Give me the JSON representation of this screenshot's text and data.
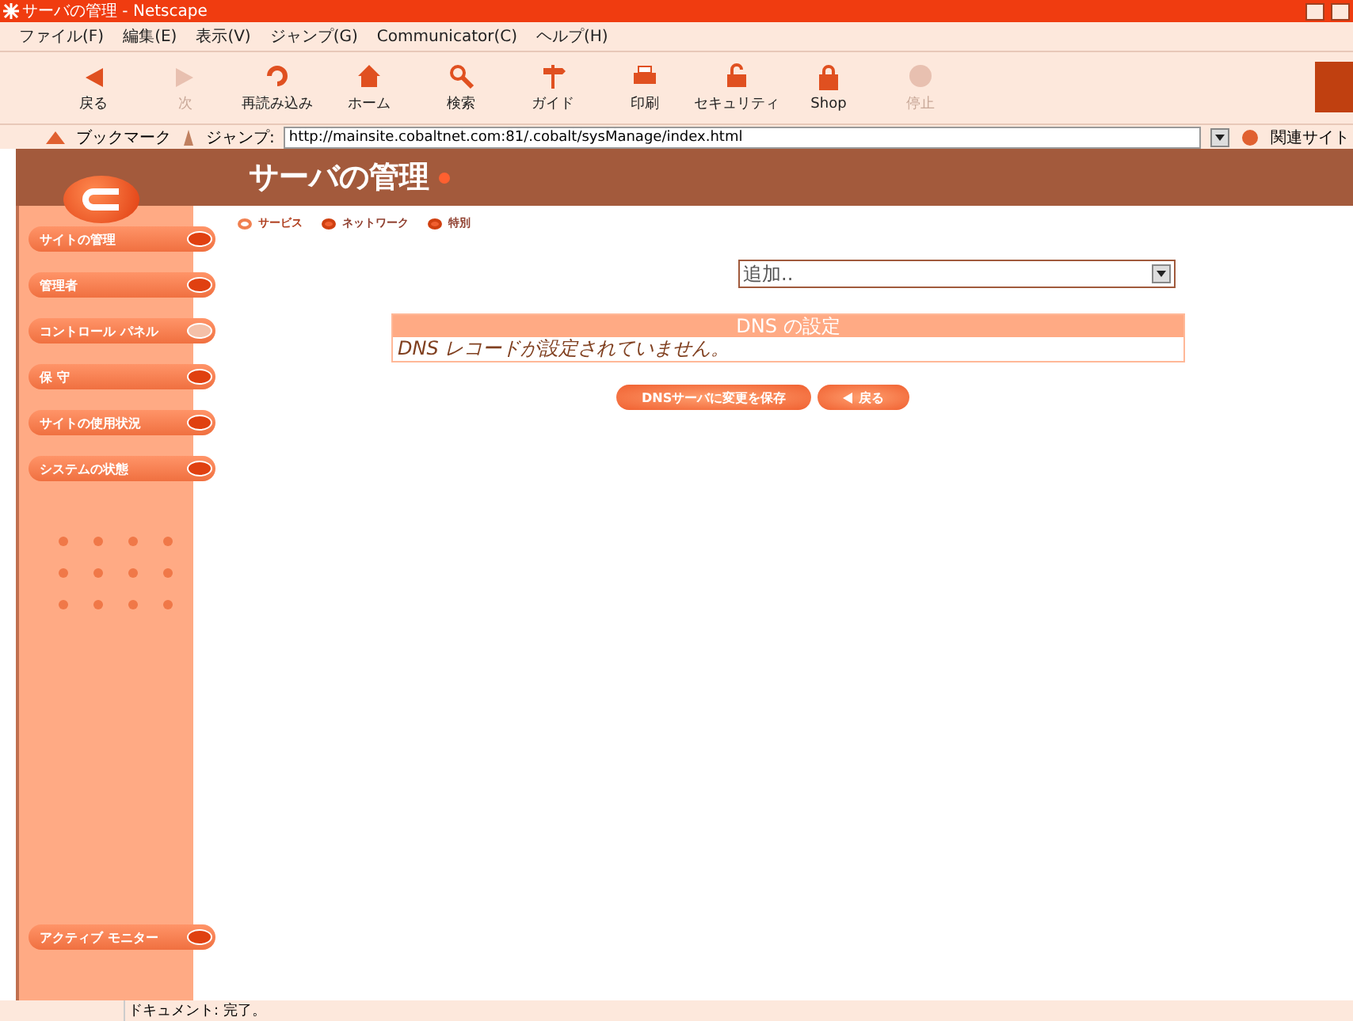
{
  "window": {
    "title": "サーバの管理 - Netscape"
  },
  "menu": [
    "ファイル(F)",
    "編集(E)",
    "表示(V)",
    "ジャンプ(G)",
    "Communicator(C)",
    "ヘルプ(H)"
  ],
  "toolbar": [
    {
      "label": "戻る",
      "kind": "back",
      "disabled": false
    },
    {
      "label": "次",
      "kind": "forward",
      "disabled": true
    },
    {
      "label": "再読み込み",
      "kind": "reload",
      "disabled": false
    },
    {
      "label": "ホーム",
      "kind": "home",
      "disabled": false
    },
    {
      "label": "検索",
      "kind": "search",
      "disabled": false
    },
    {
      "label": "ガイド",
      "kind": "guide",
      "disabled": false
    },
    {
      "label": "印刷",
      "kind": "print",
      "disabled": false
    },
    {
      "label": "セキュリティ",
      "kind": "security",
      "disabled": false
    },
    {
      "label": "Shop",
      "kind": "shop",
      "disabled": false
    },
    {
      "label": "停止",
      "kind": "stop",
      "disabled": true
    }
  ],
  "location": {
    "bookmarks": "ブックマーク",
    "jump_label": "ジャンプ:",
    "url": "http://mainsite.cobaltnet.com:81/.cobalt/sysManage/index.html",
    "related": "関連サイト"
  },
  "page": {
    "title": "サーバの管理",
    "subnav": [
      {
        "label": "サービス",
        "selected": true
      },
      {
        "label": "ネットワーク",
        "selected": false
      },
      {
        "label": "特別",
        "selected": false
      }
    ],
    "sidebar": [
      {
        "label": "サイトの管理",
        "selected": false
      },
      {
        "label": "管理者",
        "selected": false
      },
      {
        "label": "コントロール パネル",
        "selected": true
      },
      {
        "label": "保 守",
        "selected": false
      },
      {
        "label": "サイトの使用状況",
        "selected": false
      },
      {
        "label": "システムの状態",
        "selected": false
      }
    ],
    "monitor": "アクティブ モニター",
    "add_select": {
      "value": "追加.."
    },
    "dns_table": {
      "title": "DNS の設定",
      "message": "DNS レコードが設定されていません。"
    },
    "buttons": [
      {
        "label": "DNSサーバに変更を保存",
        "kind": "save"
      },
      {
        "label": "戻る",
        "kind": "back"
      }
    ]
  },
  "status_bar": {
    "text": "ドキュメント: 完了。"
  }
}
